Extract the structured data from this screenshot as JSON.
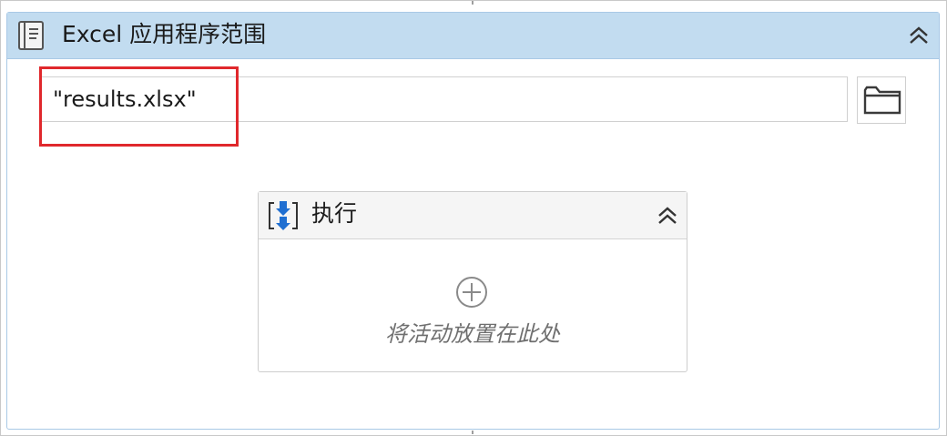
{
  "activity": {
    "title": "Excel 应用程序范围",
    "icon": "excel-workbook-icon",
    "collapse_icon": "double-chevron-up-icon",
    "accent_color": "#c2dcf0",
    "border_color": "#a9c9e6"
  },
  "workbook_path": {
    "value": "\"results.xlsx\"",
    "highlight_color": "#e0282c"
  },
  "browse": {
    "icon": "folder-icon"
  },
  "sequence": {
    "title": "执行",
    "icon": "sequence-icon",
    "collapse_icon": "double-chevron-up-icon",
    "add_icon": "plus-circle-icon",
    "drop_hint": "将活动放置在此处",
    "icon_color": "#1f6fd1"
  }
}
